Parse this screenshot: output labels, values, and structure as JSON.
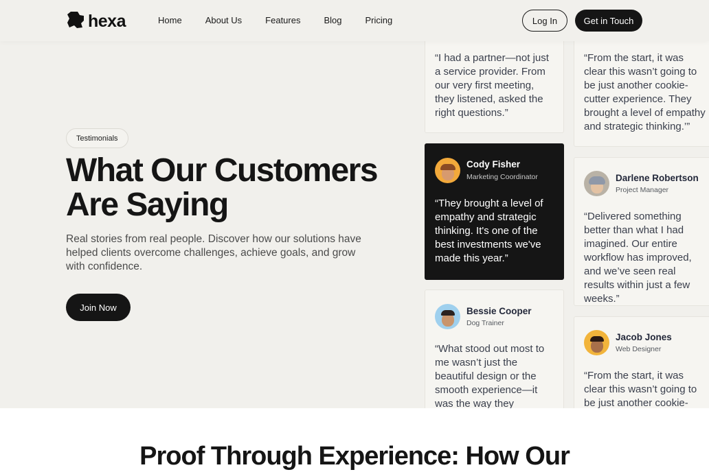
{
  "nav": {
    "logo_text": "hexa",
    "items": [
      "Home",
      "About Us",
      "Features",
      "Blog",
      "Pricing"
    ],
    "login_label": "Log In",
    "contact_label": "Get in Touch"
  },
  "hero": {
    "pill_label": "Testimonials",
    "headline_line1": "What Our Customers",
    "headline_line2": "Are Saying",
    "description": "Real stories from real people. Discover how our solutions have helped clients overcome challenges, achieve goals, and grow with confidence.",
    "cta_label": "Join Now"
  },
  "testimonials": {
    "col1": [
      {
        "quote": "“I had a partner—not just a service provider. From our very first meeting, they listened, asked the right questions.”"
      },
      {
        "name": "Cody Fisher",
        "role": "Marketing Coordinator",
        "quote": "“They brought a level of empathy and strategic thinking. It's one of the best investments we've made this year.”",
        "avatar_color": "#f2a93b"
      },
      {
        "name": "Bessie Cooper",
        "role": "Dog Trainer",
        "quote": "“What stood out most to me wasn’t just the beautiful design or the smooth experience—it was the way they communicated",
        "avatar_color": "#9fd0ee"
      }
    ],
    "col2": [
      {
        "quote": "“From the start, it was clear this wasn’t going to be just another cookie-cutter experience. They brought a level of empathy and strategic thinking.’”"
      },
      {
        "name": "Darlene Robertson",
        "role": "Project Manager",
        "quote": "“Delivered something better than what I had imagined. Our entire workflow has improved, and we’ve seen real results within just a few weeks.”",
        "avatar_color": "#b9b2a6"
      },
      {
        "name": "Jacob Jones",
        "role": "Web Designer",
        "quote": "“From the start, it was clear this wasn’t going to be just another cookie-cutter",
        "avatar_color": "#f2b43b"
      }
    ]
  },
  "section2": {
    "title": "Proof Through Experience: How Our"
  }
}
